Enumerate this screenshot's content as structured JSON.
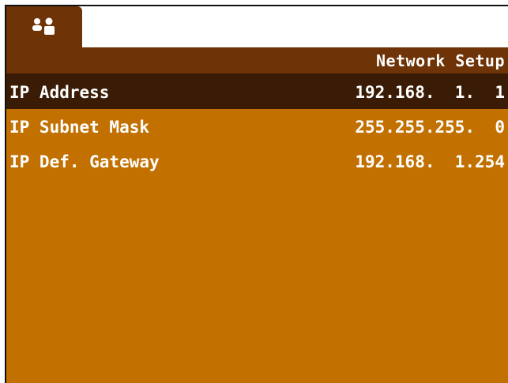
{
  "tab": {
    "icon": "network-users-icon"
  },
  "header": {
    "title": "Network Setup"
  },
  "rows": [
    {
      "label": "IP Address",
      "value": "192.168.  1.  1",
      "selected": true
    },
    {
      "label": "IP Subnet Mask",
      "value": "255.255.255.  0",
      "selected": false
    },
    {
      "label": "IP Def. Gateway",
      "value": "192.168.  1.254",
      "selected": false
    }
  ],
  "colors": {
    "background": "#c27100",
    "header": "#6e3306",
    "selected_row": "#3a1b05",
    "text": "#ffffff"
  }
}
